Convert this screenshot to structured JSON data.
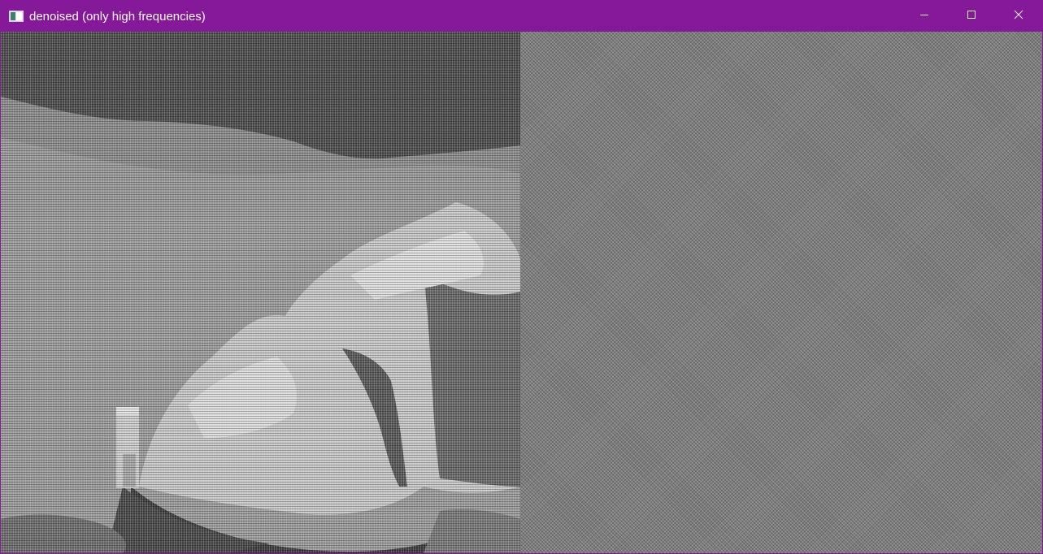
{
  "window": {
    "title": "denoised (only high frequencies)",
    "app_icon": "app-window-icon",
    "accent_color": "#86189a",
    "controls": [
      {
        "name": "minimize-button",
        "icon": "minimize-icon"
      },
      {
        "name": "maximize-button",
        "icon": "maximize-icon"
      },
      {
        "name": "close-button",
        "icon": "close-icon"
      }
    ]
  },
  "panels": {
    "left": {
      "content": "denoised grayscale image with high frequency pattern"
    },
    "right": {
      "content": "high frequency noise component"
    }
  }
}
